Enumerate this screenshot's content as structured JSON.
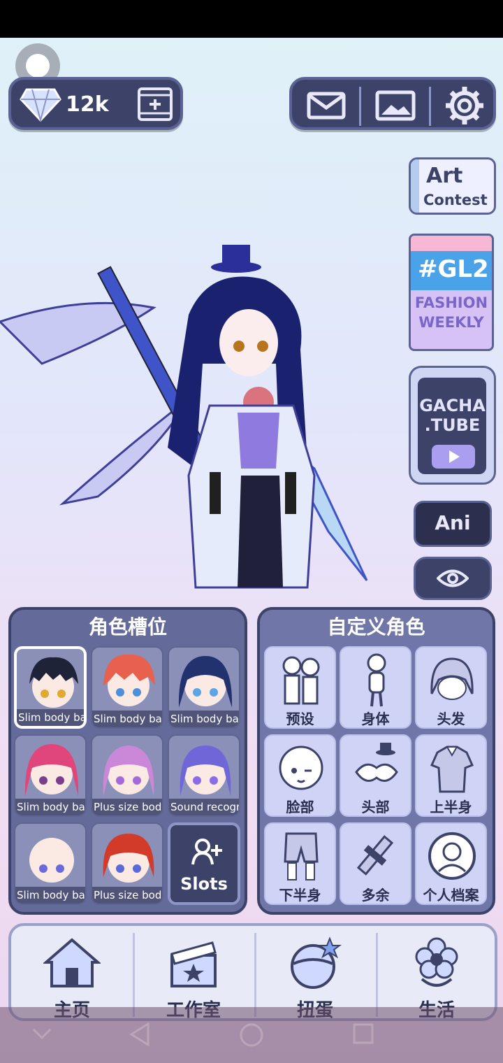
{
  "currency": {
    "gems": "12k"
  },
  "promos": {
    "art_contest": {
      "line1": "Art",
      "line2": "Contest"
    },
    "gl2": {
      "line1": "#GL2",
      "line2": "FASHION",
      "line3": "WEEKLY"
    },
    "gacha_tube": {
      "line1": "GACHA",
      "line2": ".TUBE"
    }
  },
  "side_buttons": {
    "ani": "Ani"
  },
  "slots_panel": {
    "title": "角色槽位",
    "slots": [
      {
        "label": "Slim body bas",
        "hair": "#1f2338",
        "eyes": "#e0a92f",
        "selected": true
      },
      {
        "label": "Slim body bas",
        "hair": "#e8614f",
        "eyes": "#4d8fd8"
      },
      {
        "label": "Slim body bas",
        "hair": "#22326f",
        "eyes": "#5aa6e6"
      },
      {
        "label": "Slim body bas",
        "hair": "#e0467b",
        "eyes": "#7a3f8a"
      },
      {
        "label": "Plus size body",
        "hair": "#cc88d8",
        "eyes": "#a46ad8"
      },
      {
        "label": "Sound recogn",
        "hair": "#6f66d8",
        "eyes": "#8b6be8"
      },
      {
        "label": "Slim body bas",
        "hair": "#ffffff",
        "eyes": "#6a6ad8"
      },
      {
        "label": "Plus size body",
        "hair": "#d23a2a",
        "eyes": "#5a6ad8"
      }
    ],
    "add_slot_label": "Slots"
  },
  "custom_panel": {
    "title": "自定义角色",
    "items": [
      {
        "label": "预设",
        "icon": "preset-icon"
      },
      {
        "label": "身体",
        "icon": "body-icon"
      },
      {
        "label": "头发",
        "icon": "hair-icon"
      },
      {
        "label": "脸部",
        "icon": "face-icon"
      },
      {
        "label": "头部",
        "icon": "head-accessory-icon"
      },
      {
        "label": "上半身",
        "icon": "upper-body-icon"
      },
      {
        "label": "下半身",
        "icon": "lower-body-icon"
      },
      {
        "label": "多余",
        "icon": "extra-icon"
      },
      {
        "label": "个人档案",
        "icon": "profile-icon"
      }
    ]
  },
  "bottom_nav": [
    {
      "label": "主页",
      "icon": "house-icon"
    },
    {
      "label": "工作室",
      "icon": "clapperboard-icon"
    },
    {
      "label": "扭蛋",
      "icon": "gacha-egg-icon"
    },
    {
      "label": "生活",
      "icon": "flower-icon"
    }
  ],
  "colors": {
    "panel_dark": "#3d4268",
    "accent": "#5b6394"
  }
}
